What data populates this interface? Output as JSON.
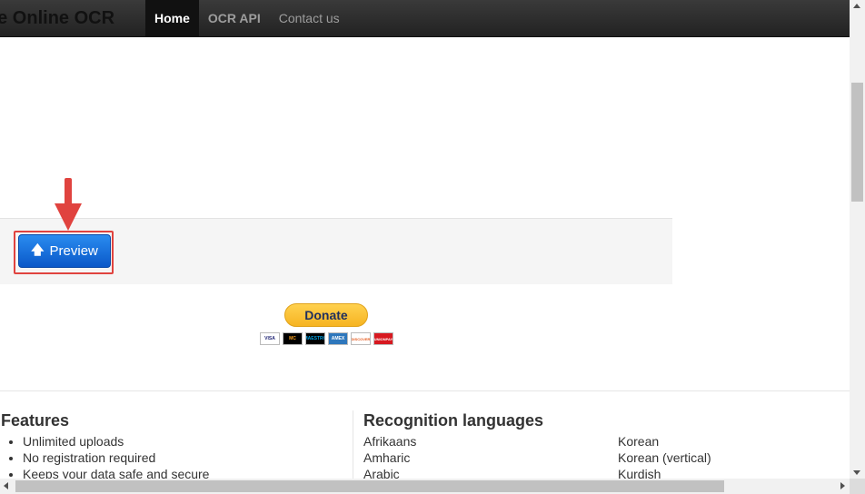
{
  "navbar": {
    "brand": "ee Online OCR",
    "items": [
      {
        "label": "Home",
        "active": true
      },
      {
        "label": "OCR API",
        "active": false
      },
      {
        "label": "Contact us",
        "active": false
      }
    ]
  },
  "upload": {
    "preview_label": "Preview",
    "preview_icon": "arrow-up-icon",
    "annotation_color": "#e0433f"
  },
  "donate": {
    "label": "Donate",
    "cards": [
      "VISA",
      "MC",
      "MAESTRO",
      "AMEX",
      "DISCOVER",
      "UNIONPAY"
    ]
  },
  "features": {
    "title": "Features",
    "items": [
      "Unlimited uploads",
      "No registration required",
      "Keeps your data safe and secure"
    ]
  },
  "languages": {
    "title": "Recognition languages",
    "col1": [
      "Afrikaans",
      "Amharic",
      "Arabic"
    ],
    "col2": [
      "Korean",
      "Korean (vertical)",
      "Kurdish"
    ]
  },
  "colors": {
    "navbar_bg": "#222222",
    "button_blue": "#0a58c8",
    "donate_yellow": "#ffc439"
  }
}
